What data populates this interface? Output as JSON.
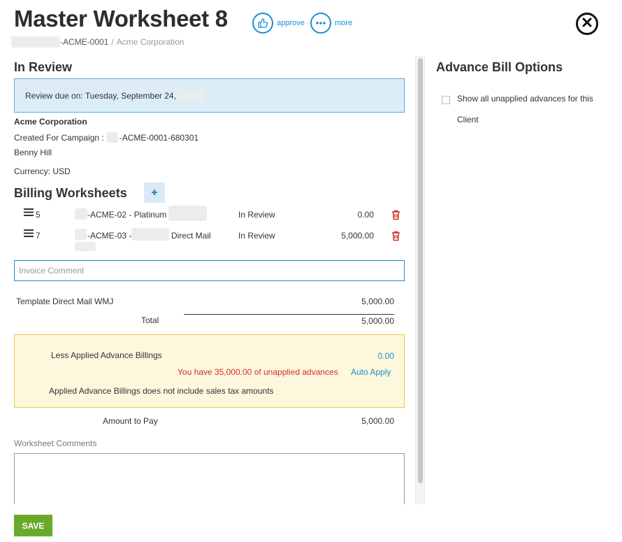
{
  "header": {
    "title": "Master Worksheet 8",
    "approve_label": "approve",
    "more_label": "more"
  },
  "breadcrumb": {
    "code": "-ACME-0001",
    "separator": "/",
    "client": "Acme Corporation"
  },
  "status": {
    "heading": "In Review",
    "review_due": "Review due on: Tuesday, September 24,"
  },
  "details": {
    "client_name": "Acme Corporation",
    "campaign_label": "Created For Campaign :",
    "campaign_code": "-ACME-0001-680301",
    "person": "Benny Hill",
    "currency": "Currency: USD"
  },
  "billing": {
    "heading": "Billing Worksheets",
    "rows": [
      {
        "num": "5",
        "name_a": "-ACME-02 - Platinum",
        "name_b": "",
        "status": "In Review",
        "amount": "0.00"
      },
      {
        "num": "7",
        "name_a": "-ACME-03 -",
        "name_b": "Direct Mail",
        "status": "In Review",
        "amount": "5,000.00"
      }
    ]
  },
  "invoice_comment": {
    "placeholder": "Invoice Comment"
  },
  "totals": {
    "line_label": "Template Direct Mail WMJ",
    "line_amount": "5,000.00",
    "total_label": "Total",
    "total_amount": "5,000.00"
  },
  "advance": {
    "less_label": "Less Applied Advance Billings",
    "less_amount": "0.00",
    "warning": "You have 35,000.00 of unapplied advances",
    "auto_apply": "Auto Apply",
    "note": "Applied Advance Billings does not include sales tax amounts"
  },
  "pay": {
    "label": "Amount to Pay",
    "amount": "5,000.00"
  },
  "comments": {
    "label": "Worksheet Comments"
  },
  "footer": {
    "save_label": "SAVE"
  },
  "options": {
    "heading": "Advance Bill Options",
    "checkbox_label_1": "Show all unapplied advances for this",
    "checkbox_label_2": "Client"
  },
  "colors": {
    "accent": "#1a8fcf",
    "danger": "#d0312d",
    "save": "#6aaa2a",
    "review_bg": "#dcedf8",
    "advance_bg": "#fdf7dd"
  }
}
